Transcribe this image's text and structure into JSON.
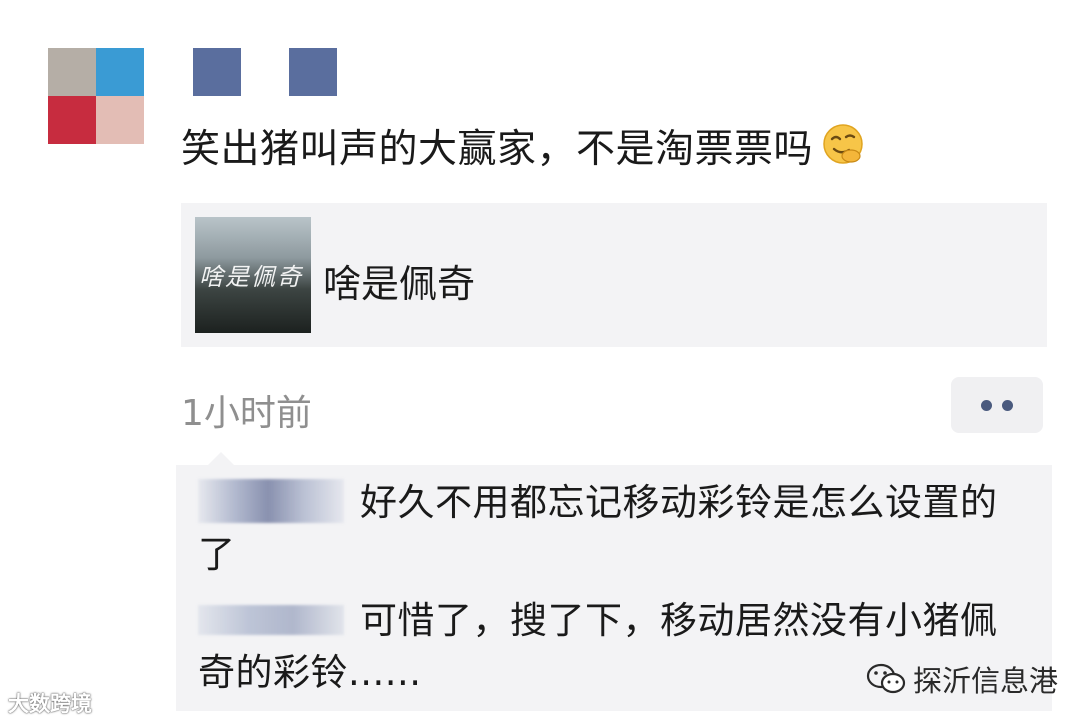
{
  "post": {
    "avatar_colors": [
      "#b5aea6",
      "#3a9bd4",
      "#c72c3f",
      "#e3bdb5"
    ],
    "name_block_color": "#5a6e9e",
    "text": "笑出猪叫声的大赢家，不是淘票票吗",
    "emoji_icon": "smirk-emoji-icon"
  },
  "link_card": {
    "thumb_caption": "啥是佩奇",
    "title": "啥是佩奇"
  },
  "meta": {
    "timestamp": "1小时前",
    "more_icon": "more-dots-icon",
    "dot_color": "#4a5a7e"
  },
  "comments": [
    {
      "text": "好久不用都忘记移动彩铃是怎么设置的了"
    },
    {
      "text": "可惜了，搜了下，移动居然没有小猪佩奇的彩铃......"
    }
  ],
  "watermarks": {
    "left": "大数跨境",
    "right": "探沂信息港",
    "right_icon": "wechat-icon"
  }
}
